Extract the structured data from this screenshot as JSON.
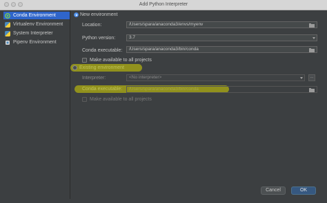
{
  "window": {
    "title": "Add Python Interpreter"
  },
  "sidebar": {
    "items": [
      {
        "label": "Conda Environment",
        "selected": true,
        "icon": "conda-icon"
      },
      {
        "label": "Virtualenv Environment",
        "selected": false,
        "icon": "python-icon"
      },
      {
        "label": "System Interpreter",
        "selected": false,
        "icon": "python-icon"
      },
      {
        "label": "Pipenv Environment",
        "selected": false,
        "icon": "pipenv-icon"
      }
    ]
  },
  "new_env": {
    "radio_label": "New environment",
    "location_label": "Location:",
    "location_value": "/Users/spara/anaconda3/envs/myenv",
    "python_version_label": "Python version:",
    "python_version_value": "3.7",
    "conda_exec_label": "Conda executable:",
    "conda_exec_value": "/Users/spara/anaconda3/bin/conda",
    "make_available_label": "Make available to all projects"
  },
  "existing_env": {
    "radio_label": "Existing environment",
    "interpreter_label": "Interpreter:",
    "interpreter_value": "<No interpreter>",
    "more_button": "...",
    "conda_exec_label": "Conda executable:",
    "conda_exec_value": "/Users/spara/anaconda3/bin/conda",
    "make_available_label": "Make available to all projects"
  },
  "buttons": {
    "cancel": "Cancel",
    "ok": "OK"
  },
  "colors": {
    "highlight": "#d7d500",
    "selection": "#2f65ca",
    "background": "#3c3f41"
  }
}
